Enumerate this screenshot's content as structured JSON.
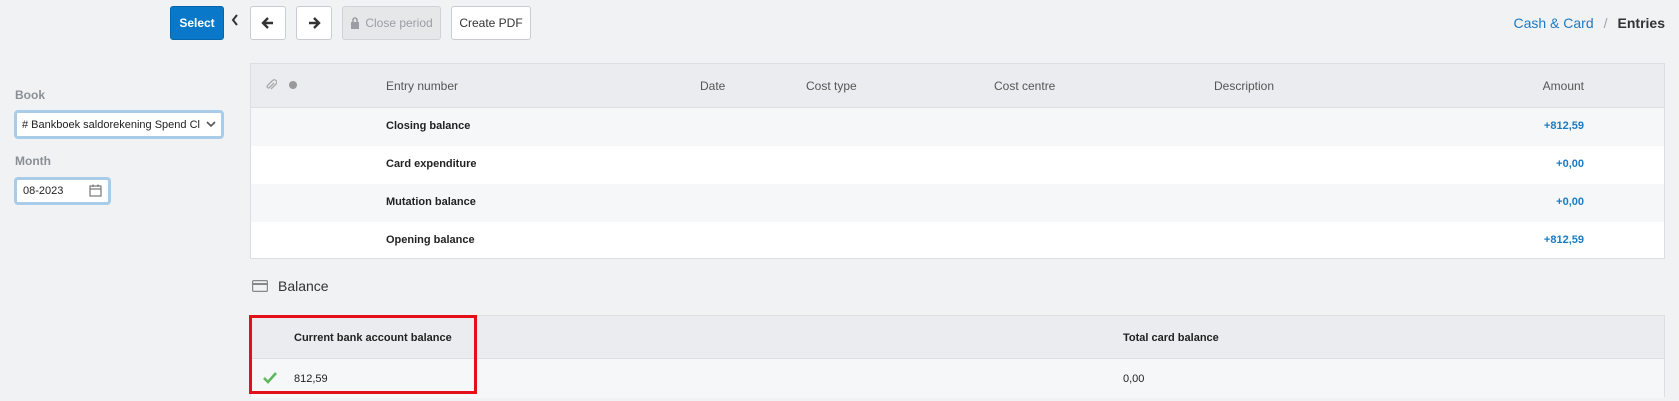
{
  "toolbar": {
    "select_label": "Select",
    "back_icon": "chevron-left-icon",
    "prev_icon": "arrow-left-icon",
    "next_icon": "arrow-right-icon",
    "close_period_label": "Close period",
    "close_period_icon": "lock-icon",
    "create_pdf_label": "Create PDF"
  },
  "breadcrumb": {
    "parent": "Cash & Card",
    "separator": "/",
    "current": "Entries"
  },
  "filters": {
    "book_label": "Book",
    "book_value": "# Bankboek saldorekening Spend Cl",
    "month_label": "Month",
    "month_value": "08-2023"
  },
  "entries": {
    "headers": {
      "entry_number": "Entry number",
      "date": "Date",
      "cost_type": "Cost type",
      "cost_centre": "Cost centre",
      "description": "Description",
      "amount": "Amount"
    },
    "rows": [
      {
        "label": "Closing balance",
        "amount": "+812,59"
      },
      {
        "label": "Card expenditure",
        "amount": "+0,00"
      },
      {
        "label": "Mutation balance",
        "amount": "+0,00"
      },
      {
        "label": "Opening balance",
        "amount": "+812,59"
      }
    ]
  },
  "balance": {
    "title": "Balance",
    "current_bank_label": "Current bank account balance",
    "current_bank_value": "812,59",
    "total_card_label": "Total card balance",
    "total_card_value": "0,00"
  },
  "colors": {
    "primary": "#0a78c8",
    "link": "#1b7bc3",
    "highlight": "#e3101a",
    "check": "#5cb85c"
  }
}
